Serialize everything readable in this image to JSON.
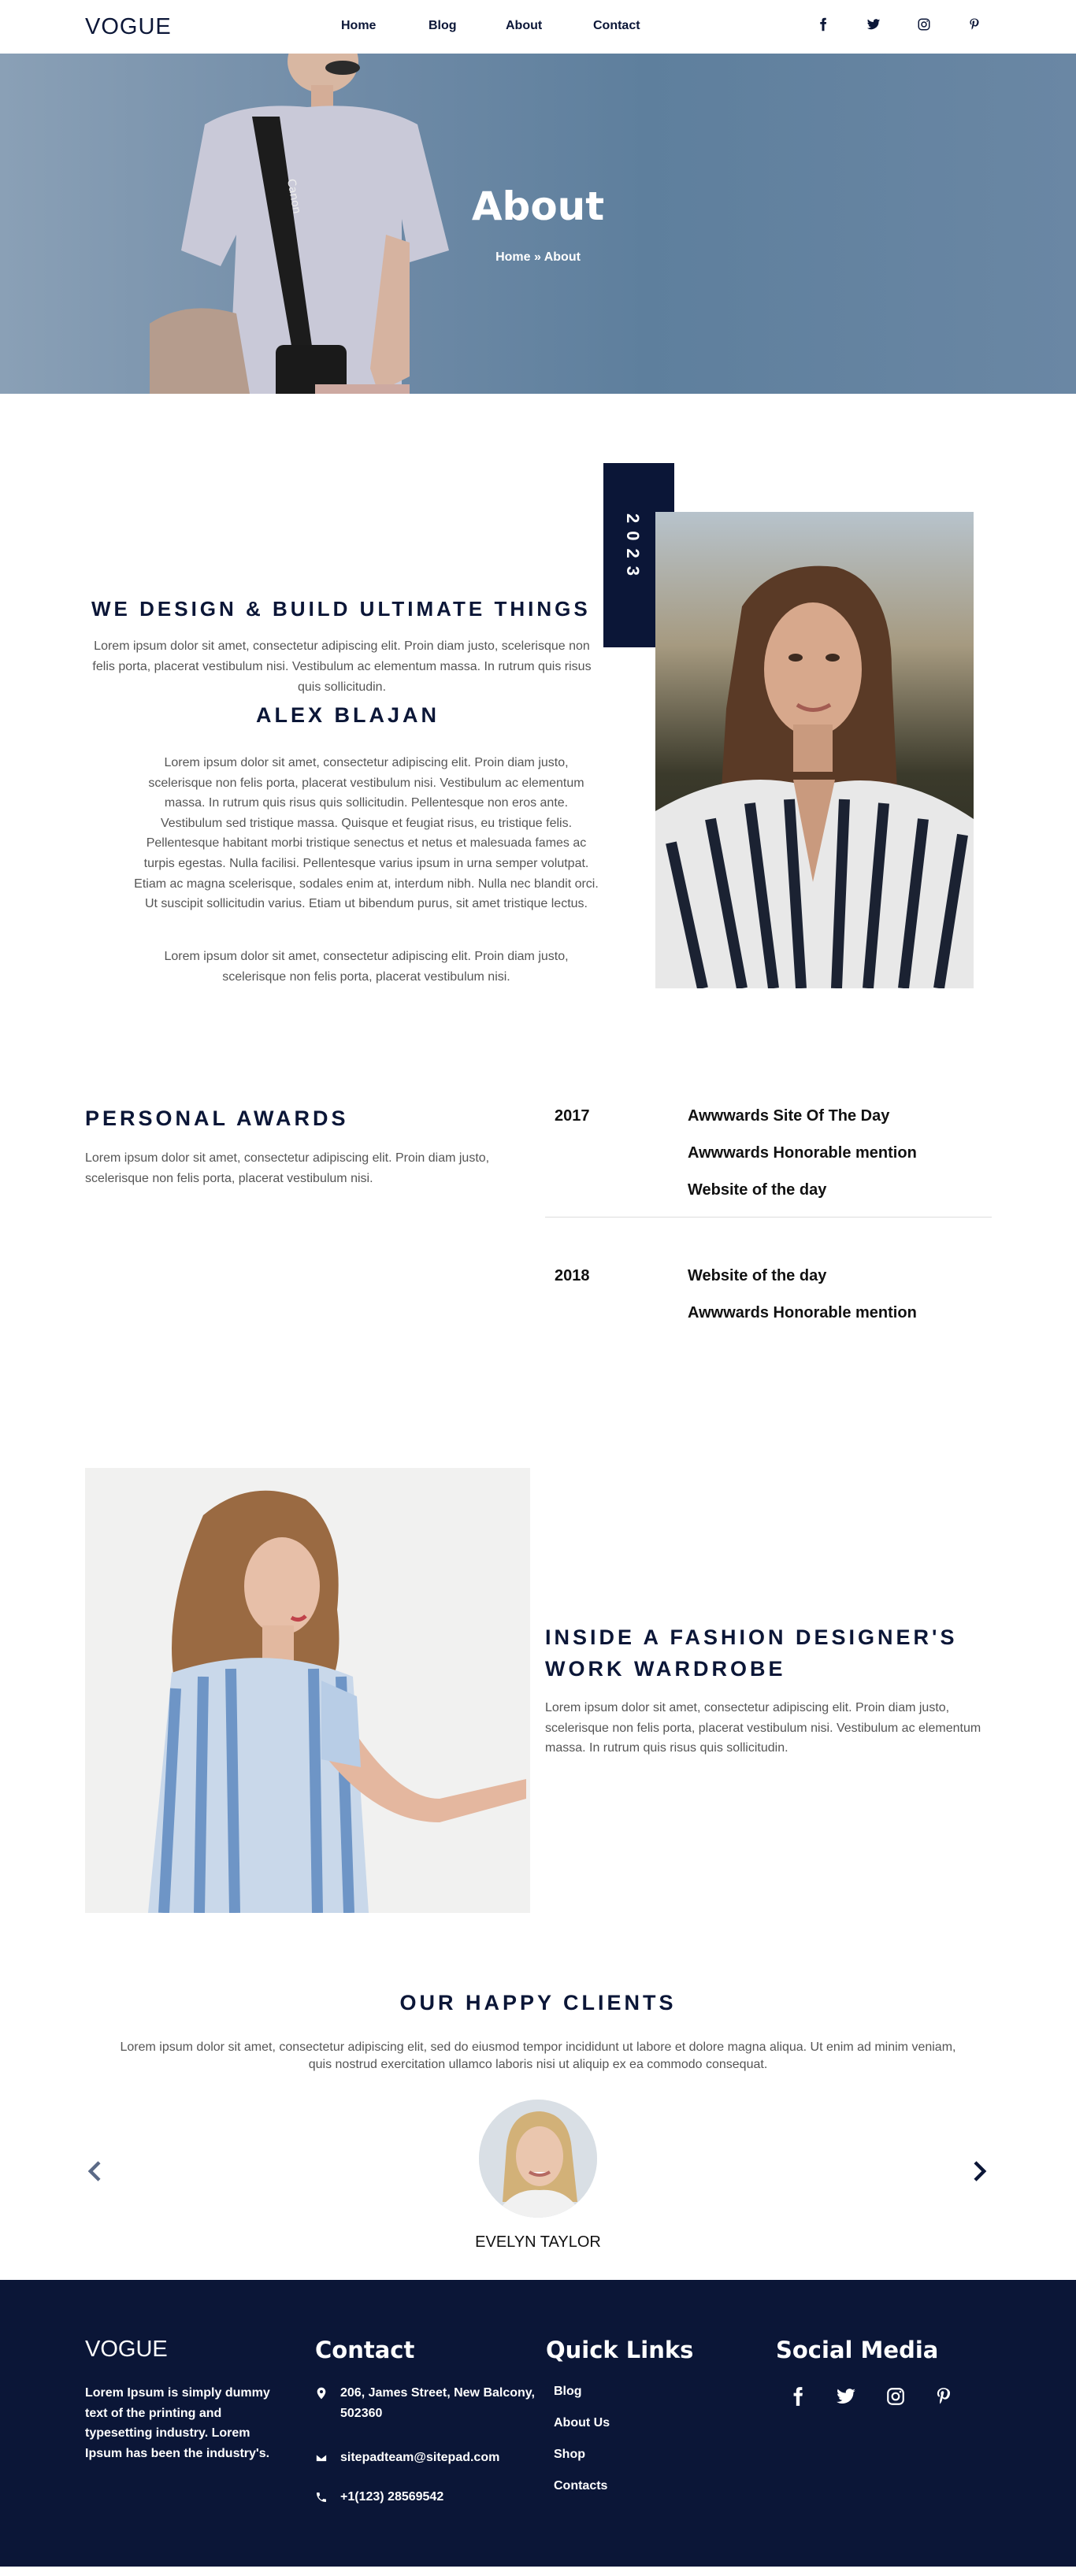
{
  "nav": {
    "logo": "VOGUE",
    "items": [
      {
        "label": "Home"
      },
      {
        "label": "Blog"
      },
      {
        "label": "About"
      },
      {
        "label": "Contact"
      }
    ],
    "social_icons": [
      "facebook-icon",
      "twitter-icon",
      "instagram-icon",
      "pinterest-icon"
    ]
  },
  "hero": {
    "title": "About",
    "breadcrumb": "Home » About"
  },
  "intro": {
    "heading": "WE DESIGN & BUILD ULTIMATE THINGS",
    "paragraph1": "Lorem ipsum dolor sit amet, consectetur adipiscing elit. Proin diam justo, scelerisque non felis porta, placerat vestibulum nisi. Vestibulum ac elementum massa. In rutrum quis risus quis sollicitudin.",
    "name": "ALEX BLAJAN",
    "paragraph2": "Lorem ipsum dolor sit amet, consectetur adipiscing elit. Proin diam justo, scelerisque non felis porta, placerat vestibulum nisi. Vestibulum ac elementum massa. In rutrum quis risus quis sollicitudin. Pellentesque non eros ante. Vestibulum sed tristique massa. Quisque et feugiat risus, eu tristique felis. Pellentesque habitant morbi tristique senectus et netus et malesuada fames ac turpis egestas. Nulla facilisi. Pellentesque varius ipsum in urna semper volutpat. Etiam ac magna scelerisque, sodales enim at, interdum nibh. Nulla nec blandit orci. Ut suscipit sollicitudin varius. Etiam ut bibendum purus, sit amet tristique lectus.",
    "paragraph3": "Lorem ipsum dolor sit amet, consectetur adipiscing elit. Proin diam justo, scelerisque non felis porta, placerat vestibulum nisi.",
    "year": "2023"
  },
  "awards": {
    "title": "PERSONAL AWARDS",
    "paragraph": "Lorem ipsum dolor sit amet, consectetur adipiscing elit. Proin diam justo, scelerisque non felis porta, placerat vestibulum nisi.",
    "groups": [
      {
        "year": "2017",
        "items": [
          "Awwwards Site Of The Day",
          "Awwwards Honorable mention",
          "Website of the day"
        ]
      },
      {
        "year": "2018",
        "items": [
          "Website of the day",
          "Awwwards Honorable mention"
        ]
      }
    ]
  },
  "designer": {
    "title": "INSIDE A FASHION DESIGNER'S WORK WARDROBE",
    "paragraph": "Lorem ipsum dolor sit amet, consectetur adipiscing elit. Proin diam justo, scelerisque non felis porta, placerat vestibulum nisi. Vestibulum ac elementum massa. In rutrum quis risus quis sollicitudin."
  },
  "clients": {
    "title": "OUR HAPPY CLIENTS",
    "paragraph": "Lorem ipsum dolor sit amet, consectetur adipiscing elit, sed do eiusmod tempor incididunt ut labore et dolore magna aliqua. Ut enim ad minim veniam, quis nostrud exercitation ullamco laboris nisi ut aliquip ex ea commodo consequat.",
    "client_name": "EVELYN TAYLOR",
    "prev_icon": "chevron-left-icon",
    "next_icon": "chevron-right-icon"
  },
  "footer": {
    "logo": "VOGUE",
    "about": "Lorem Ipsum is simply dummy text of the printing and typesetting industry. Lorem Ipsum has been the industry's.",
    "contact_heading": "Contact",
    "address": "206, James Street, New Balcony, 502360",
    "email": "sitepadteam@sitepad.com",
    "phone": "+1(123) 28569542",
    "quicklinks_heading": "Quick Links",
    "links": [
      "Blog",
      "About Us",
      "Shop",
      "Contacts"
    ],
    "social_heading": "Social Media",
    "social_icons": [
      "facebook-icon",
      "twitter-icon",
      "instagram-icon",
      "pinterest-icon"
    ]
  },
  "colors": {
    "navy": "#0b1637",
    "text_gray": "#555555",
    "white": "#ffffff"
  }
}
